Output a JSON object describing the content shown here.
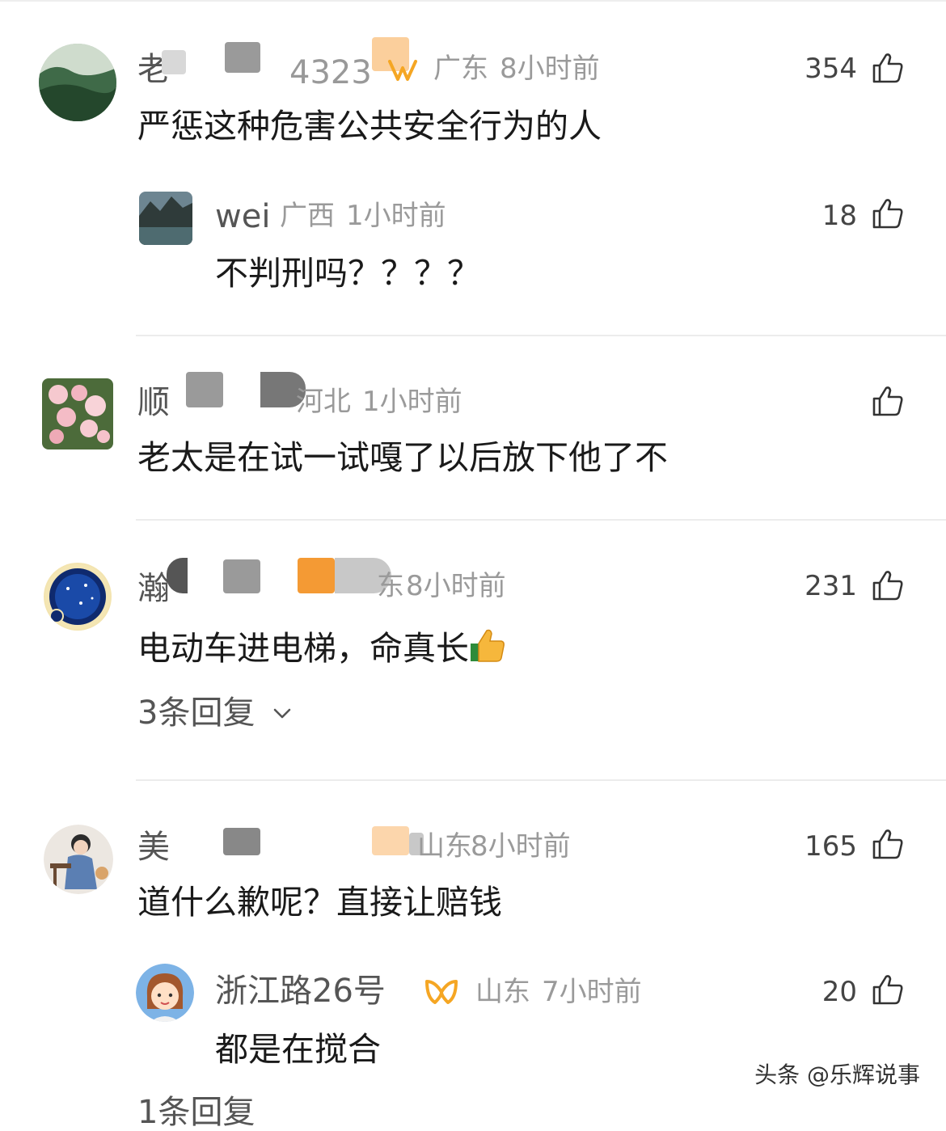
{
  "comments": [
    {
      "name": "老",
      "name_tail": "4323",
      "location": "广东",
      "time": "8小时前",
      "likes": "354",
      "text": "严惩这种危害公共安全行为的人",
      "reply": {
        "name": "wei",
        "location": "广西",
        "time": "1小时前",
        "likes": "18",
        "text": "不判刑吗？？？？"
      }
    },
    {
      "name": "顺",
      "location": "河北",
      "time": "1小时前",
      "likes": "",
      "text": "老太是在试一试嘎了以后放下他了不"
    },
    {
      "name": "瀚",
      "location": "东",
      "time": "8小时前",
      "likes": "231",
      "text": "电动车进电梯，命真长",
      "emoji": "👍",
      "replies_link": "3条回复"
    },
    {
      "name": "美",
      "location": "山东",
      "time": "8小时前",
      "likes": "165",
      "text": "道什么歉呢？直接让赔钱",
      "reply": {
        "name": "浙江路26号",
        "location": "山东",
        "time": "7小时前",
        "likes": "20",
        "text": "都是在搅合"
      },
      "replies_link": "1条回复"
    }
  ],
  "watermark": "头条 @乐辉说事",
  "colors": {
    "accent_badge": "#f5a623",
    "meta": "#9a9a9a",
    "divider": "#ececec"
  }
}
